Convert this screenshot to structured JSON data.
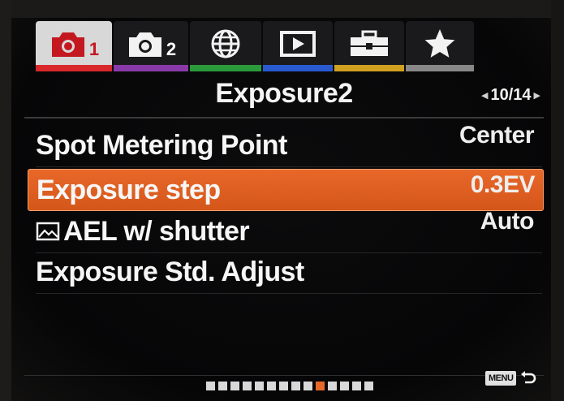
{
  "tabs": [
    {
      "icon": "camera-icon",
      "number": "1",
      "color": "#d8282c",
      "active": true
    },
    {
      "icon": "camera-icon",
      "number": "2",
      "color": "#8a3aa8",
      "active": false
    },
    {
      "icon": "globe-icon",
      "number": "",
      "color": "#2a9a3a",
      "active": false
    },
    {
      "icon": "play-icon",
      "number": "",
      "color": "#2a5ad0",
      "active": false
    },
    {
      "icon": "toolbox-icon",
      "number": "",
      "color": "#d0a020",
      "active": false
    },
    {
      "icon": "star-icon",
      "number": "",
      "color": "#888888",
      "active": false
    }
  ],
  "header": {
    "title": "Exposure2",
    "page": "10/14"
  },
  "menu": {
    "items": [
      {
        "label": "Spot Metering Point",
        "value": "Center",
        "selected": false
      },
      {
        "label": "Exposure step",
        "value": "0.3EV",
        "selected": true
      },
      {
        "label": "AEL w/ shutter",
        "value": "Auto",
        "selected": false,
        "icon": "ael-shutter-icon"
      },
      {
        "label": "Exposure Std. Adjust",
        "value": "",
        "selected": false
      }
    ]
  },
  "pagination": {
    "total": 14,
    "current": 10
  },
  "footer": {
    "menu_label": "MENU",
    "back_icon": "return-icon"
  },
  "colors": {
    "accent": "#e8682a",
    "background": "#080809"
  }
}
